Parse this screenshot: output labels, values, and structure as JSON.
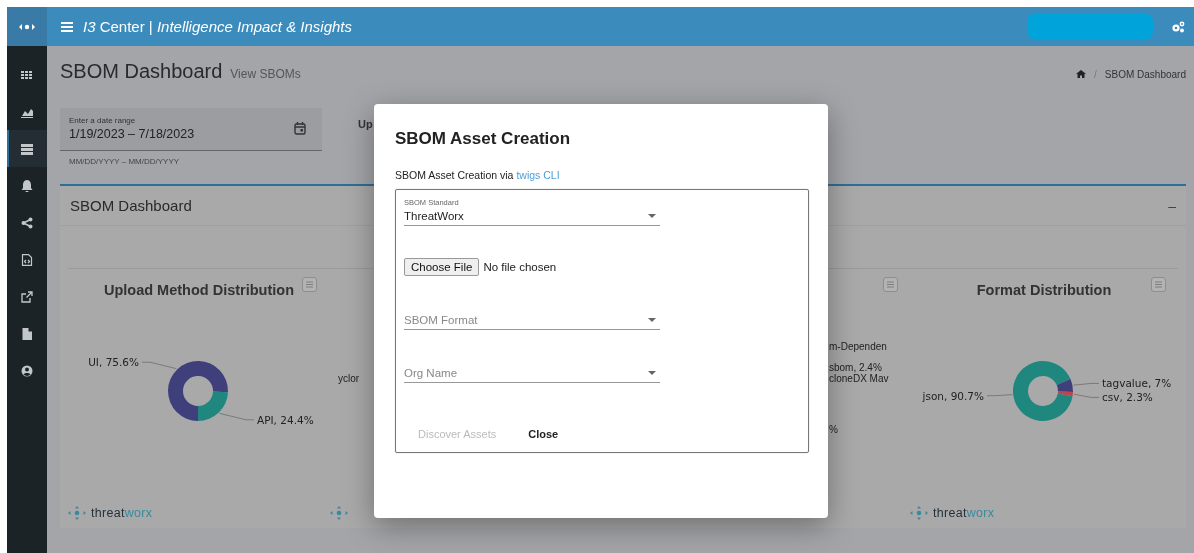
{
  "sidebar": {
    "items": [
      {
        "kind": "grid",
        "selected": false
      },
      {
        "kind": "area-chart",
        "selected": false
      },
      {
        "kind": "table",
        "selected": true
      },
      {
        "kind": "bell",
        "selected": false
      },
      {
        "kind": "share",
        "selected": false
      },
      {
        "kind": "file-code",
        "selected": false
      },
      {
        "kind": "external-link",
        "selected": false
      },
      {
        "kind": "file",
        "selected": false
      },
      {
        "kind": "user",
        "selected": false
      }
    ]
  },
  "top_bar": {
    "title": "*I3* Center | *Intelligence Impact & Insights*"
  },
  "page_header": {
    "title": "SBOM Dashboard",
    "subtitle": "View SBOMs"
  },
  "breadcrumb": {
    "separator": "/",
    "current": "SBOM Dashboard"
  },
  "date_range": {
    "label": "Enter a date range",
    "value": "1/19/2023 – 7/18/2023",
    "hint": "MM/DD/YYYY – MM/DD/YYYY"
  },
  "filter_label_fragment": "Up",
  "panel": {
    "title": "SBOM Dashboard",
    "collapse": "–",
    "charts": [
      {
        "kind": "donut",
        "logo": {
          "lead": "threat",
          "tail": "worx"
        },
        "chart_data": {
          "type": "donut",
          "title": "Upload Method Distribution",
          "categories": [
            "UI, 75.6%",
            "API, 24.4%"
          ],
          "values": [
            75.6,
            24.4
          ],
          "colors": [
            "#3e3f7b",
            "#1f877e"
          ]
        }
      },
      {
        "kind": "hidden",
        "labels_left": [
          "yclor"
        ],
        "labels_right": [
          "m-Dependen",
          "sbom, 2.4%",
          "cloneDX Mav",
          "%"
        ]
      },
      {
        "kind": "donut",
        "logo": {
          "lead": "threat",
          "tail": "worx"
        },
        "chart_data": {
          "type": "donut",
          "title": "Format Distribution",
          "categories": [
            "json, 90.7%",
            "tagvalue, 7%",
            "csv, 2.3%"
          ],
          "values": [
            90.7,
            7,
            2.3
          ],
          "colors": [
            "#1f877e",
            "#3e3f7b",
            "#b8464c"
          ]
        }
      }
    ]
  },
  "dialog": {
    "title": "SBOM Asset Creation",
    "intro": "SBOM Asset Creation via",
    "link": "twigs CLI",
    "fields": [
      {
        "kind": "select",
        "label": "SBOM Standard",
        "value": "ThreatWorx"
      },
      {
        "kind": "file",
        "button": "Choose File",
        "status": "No file chosen"
      },
      {
        "kind": "select",
        "placeholder": "SBOM Format"
      },
      {
        "kind": "select",
        "placeholder": "Org Name"
      }
    ],
    "buttons": [
      {
        "label": "Discover Assets",
        "disabled": true
      },
      {
        "label": "Close",
        "disabled": false
      }
    ]
  }
}
